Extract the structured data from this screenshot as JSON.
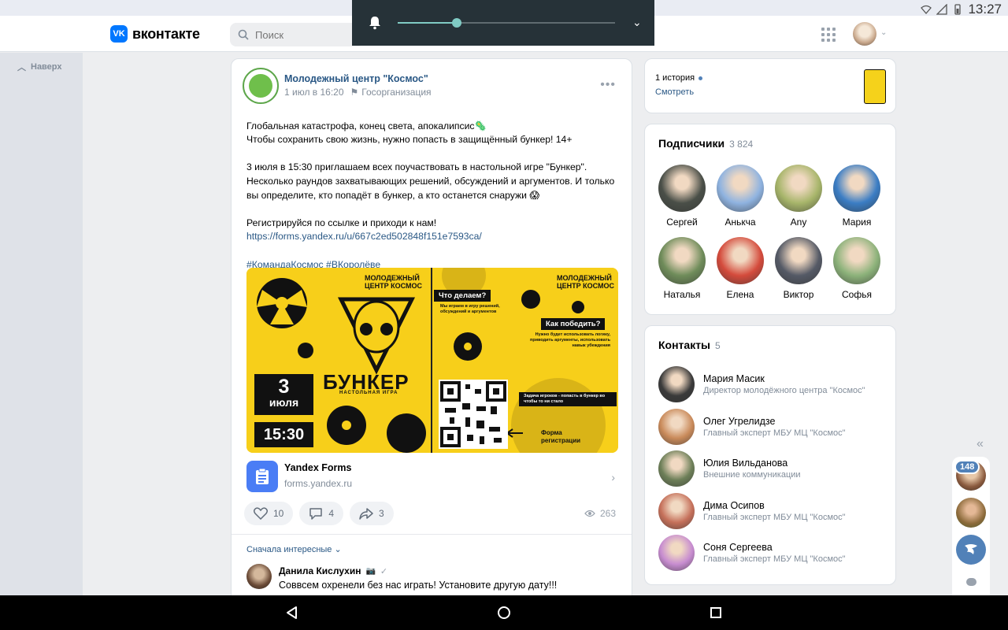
{
  "status_bar": {
    "time": "13:27"
  },
  "header": {
    "logo_badge": "VK",
    "logo_text": "вконтакте",
    "search_placeholder": "Поиск"
  },
  "volume": {
    "level": 0.27
  },
  "left": {
    "up_label": "Наверх"
  },
  "post": {
    "author": "Молодежный центр \"Космос\"",
    "date": "1 июл в 16:20",
    "category": "Госорганизация",
    "text_lines": [
      "Глобальная катастрофа, конец света, апокалипсис🦠",
      "Чтобы сохранить свою жизнь, нужно попасть в защищённый бункер! 14+",
      "",
      "3 июля в 15:30 приглашаем всех поучаствовать в настольной игре \"Бункер\".",
      "Несколько раундов захватывающих решений, обсуждений и аргументов. И только",
      "вы определите, кто попадёт в бункер, а кто останется снаружи 😱",
      "",
      "Регистрируйся по ссылке и приходи к нам!"
    ],
    "link": "https://forms.yandex.ru/u/667c2ed502848f151e7593ca/",
    "hashtags": "#КомандаКосмос #ВКоролёве",
    "image": {
      "brand": "МОЛОДЕЖНЫЙ ЦЕНТР КОСМОС",
      "title": "БУНКЕР",
      "subtitle": "НАСТОЛЬНАЯ ИГРА",
      "day": "3",
      "month": "июля",
      "time": "15:30",
      "q1": "Что делаем?",
      "a1": "Мы играем в игру решений, обсуждений и аргументов",
      "q2": "Как победить?",
      "a2": "Нужно будет использовать логику, приводить аргументы, использовать навык убеждения",
      "task": "Задача игроков - попасть в бункер во чтобы то ни стало",
      "form_label": "Форма регистрации"
    },
    "attachment": {
      "title": "Yandex Forms",
      "url": "forms.yandex.ru"
    },
    "likes": "10",
    "comments": "4",
    "shares": "3",
    "views": "263",
    "sort_label": "Сначала интересные",
    "comment": {
      "author": "Данила Кислухин",
      "text": "Соввсем охренели без нас играть! Установите другую дату!!!"
    }
  },
  "stories": {
    "count_label": "1 история",
    "watch": "Смотреть"
  },
  "subscribers": {
    "title": "Подписчики",
    "count": "3 824",
    "items": [
      {
        "name": "Сергей",
        "color": "#4a4f48"
      },
      {
        "name": "Анькча",
        "color": "#8fb3e0"
      },
      {
        "name": "Any",
        "color": "#a7b56a"
      },
      {
        "name": "Мария",
        "color": "#3b7dc4"
      },
      {
        "name": "Наталья",
        "color": "#6f8c5a"
      },
      {
        "name": "Елена",
        "color": "#d44b3c"
      },
      {
        "name": "Виктор",
        "color": "#555a66"
      },
      {
        "name": "Софья",
        "color": "#8cb27a"
      }
    ]
  },
  "contacts": {
    "title": "Контакты",
    "count": "5",
    "items": [
      {
        "name": "Мария Масик",
        "role": "Директор молодёжного центра \"Космос\"",
        "color": "#3a3a3a"
      },
      {
        "name": "Олег Угрелидзе",
        "role": "Главный эксперт МБУ МЦ \"Космос\"",
        "color": "#c98a5a"
      },
      {
        "name": "Юлия Вильданова",
        "role": "Внешние коммуникации",
        "color": "#6d7f58"
      },
      {
        "name": "Дима Осипов",
        "role": "Главный эксперт МБУ МЦ \"Космос\"",
        "color": "#c5705a"
      },
      {
        "name": "Соня Сергеева",
        "role": "Главный эксперт МБУ МЦ \"Космос\"",
        "color": "#c78cd0"
      }
    ]
  },
  "chat": {
    "badge": "148"
  }
}
